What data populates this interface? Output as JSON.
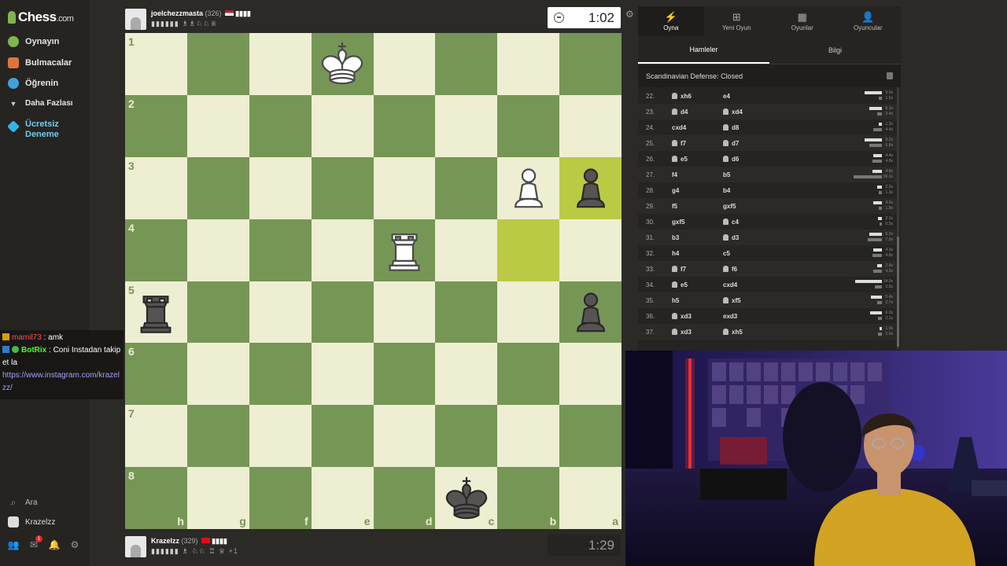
{
  "brand": {
    "name": "Chess",
    "suffix": ".com"
  },
  "sidebar": {
    "items": [
      {
        "label": "Oynayın",
        "icon": "play-icon",
        "color": "#81b64c"
      },
      {
        "label": "Bulmacalar",
        "icon": "puzzle-icon",
        "color": "#e0743e"
      },
      {
        "label": "Öğrenin",
        "icon": "learn-icon",
        "color": "#3ea3d6"
      },
      {
        "label": "Daha Fazlası",
        "icon": "chevron-down-icon",
        "color": "#cccccc"
      },
      {
        "label": "Ücretsiz Deneme",
        "icon": "diamond-icon",
        "color": "#31b6e8"
      }
    ],
    "search_label": "Ara",
    "user_label": "Krazelzz",
    "notification_count": "1"
  },
  "chat": [
    {
      "user": "mamil73",
      "text": " : amk"
    },
    {
      "user": "BotRix",
      "text": " : Coni Instadan takip et la"
    },
    {
      "link": "https://www.instagram.com/krazelzz/"
    }
  ],
  "top_player": {
    "name": "joelchezzmasta",
    "rating": "(326)",
    "extra": "▮▮▮▮",
    "captured": "▮▮▮▮▮▮ ♗♗♘♘♕"
  },
  "bottom_player": {
    "name": "Krazelzz",
    "rating": "(329)",
    "extra": "▮▮▮▮",
    "captured": "▮▮▮▮▮▮ ♗ ♘♘ ♖ ♕",
    "advantage": "+1"
  },
  "clocks": {
    "top": "1:02",
    "bottom": "1:29"
  },
  "board": {
    "ranks": [
      "1",
      "2",
      "3",
      "4",
      "5",
      "6",
      "7",
      "8"
    ],
    "files": [
      "h",
      "g",
      "f",
      "e",
      "d",
      "c",
      "b",
      "a"
    ],
    "highlight": [
      [
        2,
        7
      ],
      [
        3,
        6
      ]
    ],
    "pieces": [
      {
        "type": "king",
        "color": "white",
        "row": 0,
        "col": 3
      },
      {
        "type": "pawn",
        "color": "white",
        "row": 2,
        "col": 6
      },
      {
        "type": "pawn",
        "color": "black",
        "row": 2,
        "col": 7
      },
      {
        "type": "rook",
        "color": "white",
        "row": 3,
        "col": 4
      },
      {
        "type": "rook",
        "color": "black",
        "row": 4,
        "col": 0
      },
      {
        "type": "pawn",
        "color": "black",
        "row": 4,
        "col": 7
      },
      {
        "type": "king",
        "color": "black",
        "row": 7,
        "col": 5
      }
    ]
  },
  "right_panel": {
    "tabs": [
      {
        "label": "Oyna",
        "icon": "lightning-icon"
      },
      {
        "label": "Yeni Oyun",
        "icon": "plus-icon"
      },
      {
        "label": "Oyunlar",
        "icon": "board-icon"
      },
      {
        "label": "Oyuncular",
        "icon": "players-icon"
      }
    ],
    "subtabs": [
      "Hamleler",
      "Bilgi"
    ],
    "opening": "Scandinavian Defense: Closed",
    "moves": [
      {
        "n": "22.",
        "w": "xh6",
        "wp": true,
        "b": "e4",
        "bp": false,
        "wt": "9.0s",
        "bt": "1.5s",
        "wf": 0.6,
        "bf": 0.1
      },
      {
        "n": "23.",
        "w": "d4",
        "wp": true,
        "b": "xd4",
        "bp": true,
        "wt": "6.1s",
        "bt": "2.4s",
        "wf": 0.45,
        "bf": 0.18
      },
      {
        "n": "24.",
        "w": "cxd4",
        "wp": false,
        "b": "d8",
        "bp": true,
        "wt": "1.2s",
        "bt": "4.4s",
        "wf": 0.1,
        "bf": 0.3
      },
      {
        "n": "25.",
        "w": "f7",
        "wp": true,
        "b": "d7",
        "bp": true,
        "wt": "9.2s",
        "bt": "6.8s",
        "wf": 0.6,
        "bf": 0.45
      },
      {
        "n": "26.",
        "w": "e5",
        "wp": true,
        "b": "d6",
        "bp": true,
        "wt": "4.4s",
        "bt": "4.8s",
        "wf": 0.3,
        "bf": 0.32
      },
      {
        "n": "27.",
        "w": "f4",
        "wp": false,
        "b": "b5",
        "bp": false,
        "wt": "4.8s",
        "bt": "30.2s",
        "wf": 0.32,
        "bf": 1.0
      },
      {
        "n": "28.",
        "w": "g4",
        "wp": false,
        "b": "b4",
        "bp": false,
        "wt": "2.5s",
        "bt": "1.3s",
        "wf": 0.18,
        "bf": 0.1
      },
      {
        "n": "29.",
        "w": "f5",
        "wp": false,
        "b": "gxf5",
        "bp": false,
        "wt": "4.0s",
        "bt": "1.8s",
        "wf": 0.3,
        "bf": 0.12
      },
      {
        "n": "30.",
        "w": "gxf5",
        "wp": false,
        "b": "c4",
        "bp": true,
        "wt": "2.1s",
        "bt": "0.5s",
        "wf": 0.15,
        "bf": 0.05
      },
      {
        "n": "31.",
        "w": "b3",
        "wp": false,
        "b": "d3",
        "bp": true,
        "wt": "6.2s",
        "bt": "7.9s",
        "wf": 0.45,
        "bf": 0.5
      },
      {
        "n": "32.",
        "w": "h4",
        "wp": false,
        "b": "c5",
        "bp": false,
        "wt": "4.3s",
        "bt": "4.8s",
        "wf": 0.3,
        "bf": 0.32
      },
      {
        "n": "33.",
        "w": "f7",
        "wp": true,
        "b": "f6",
        "bp": true,
        "wt": "2.6s",
        "bt": "4.5s",
        "wf": 0.18,
        "bf": 0.3
      },
      {
        "n": "34.",
        "w": "e5",
        "wp": true,
        "b": "cxd4",
        "bp": false,
        "wt": "14.0s",
        "bt": "3.6s",
        "wf": 0.95,
        "bf": 0.25
      },
      {
        "n": "35.",
        "w": "h5",
        "wp": false,
        "b": "xf5",
        "bp": true,
        "wt": "5.4s",
        "bt": "2.7s",
        "wf": 0.38,
        "bf": 0.18
      },
      {
        "n": "36.",
        "w": "xd3",
        "wp": true,
        "b": "exd3",
        "bp": false,
        "wt": "6.0s",
        "bt": "2.1s",
        "wf": 0.42,
        "bf": 0.15
      },
      {
        "n": "37.",
        "w": "xd3",
        "wp": true,
        "b": "xh5",
        "bp": true,
        "wt": "1.0s",
        "bt": "1.9s",
        "wf": 0.08,
        "bf": 0.13
      }
    ]
  },
  "colors": {
    "board_light": "#eeeed2",
    "board_dark": "#769656",
    "highlight": "#baca44",
    "panel_bg": "#262421"
  }
}
